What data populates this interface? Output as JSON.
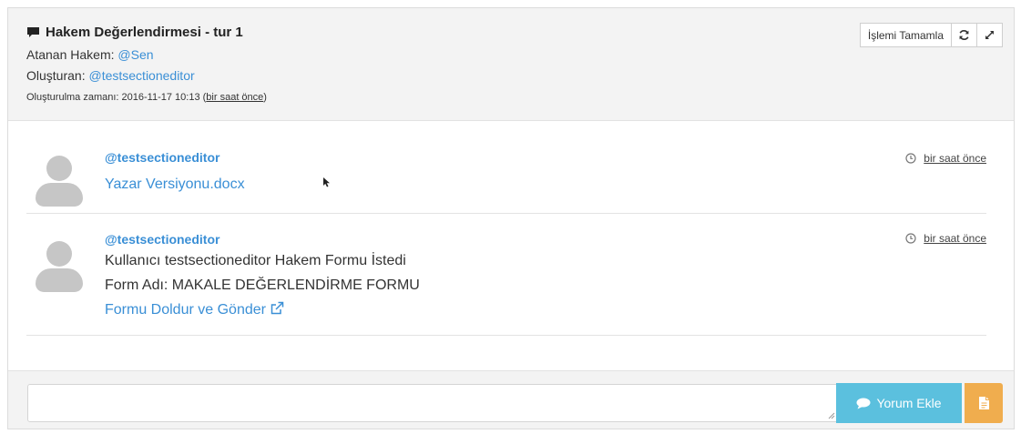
{
  "header": {
    "title": "Hakem Değerlendirmesi - tur 1",
    "assigned_label": "Atanan Hakem:",
    "assigned_value": "@Sen",
    "creator_label": "Oluşturan:",
    "creator_value": "@testsectioneditor",
    "created_label": "Oluşturulma zamanı: 2016-11-17 10:13 (",
    "created_relative": "bir saat önce",
    "created_close": ")",
    "complete_button": "İşlemi Tamamla",
    "icons": [
      "comment-icon",
      "refresh-icon",
      "expand-icon"
    ]
  },
  "entries": [
    {
      "user": "@testsectioneditor",
      "lines": [
        {
          "text": "Yazar Versiyonu.docx",
          "link": true
        }
      ],
      "time": "bir saat önce"
    },
    {
      "user": "@testsectioneditor",
      "lines": [
        {
          "text": "Kullanıcı testsectioneditor Hakem Formu İstedi",
          "link": false
        },
        {
          "text": "Form Adı: MAKALE DEĞERLENDİRME FORMU",
          "link": false
        },
        {
          "text": "Formu Doldur ve Gönder",
          "link": true
        }
      ],
      "time": "bir saat önce"
    }
  ],
  "footer": {
    "comment_placeholder": "",
    "add_button": "Yorum Ekle",
    "icons": [
      "comment-icon",
      "file-icon"
    ]
  },
  "colors": {
    "link": "#3a8fd6",
    "info_button": "#5bc0de",
    "warning_button": "#f0ad4e",
    "header_bg": "#f3f3f3",
    "avatar": "#c6c6c6"
  }
}
